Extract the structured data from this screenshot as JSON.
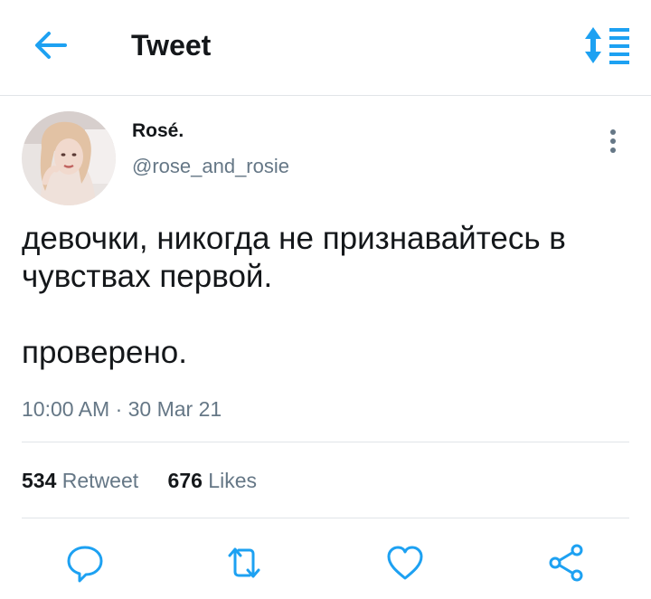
{
  "header": {
    "title": "Tweet",
    "back_icon": "arrow-left-icon",
    "sort_icon": "sort-list-icon"
  },
  "tweet": {
    "author_name": "Rosé.",
    "author_handle": "@rose_and_rosie",
    "text_lines": [
      "девочки, никогда не признавайтесь в",
      "чувствах первой.",
      "проверено."
    ],
    "timestamp": "10:00 AM · 30 Mar 21",
    "retweets_count": "534",
    "retweets_label": "Retweet",
    "likes_count": "676",
    "likes_label": "Likes"
  },
  "actions": [
    "reply-icon",
    "retweet-icon",
    "like-icon",
    "share-icon"
  ],
  "colors": {
    "accent": "#1da1f2",
    "text": "#14171a",
    "secondary": "#657786",
    "icon": "#1da1f2"
  }
}
